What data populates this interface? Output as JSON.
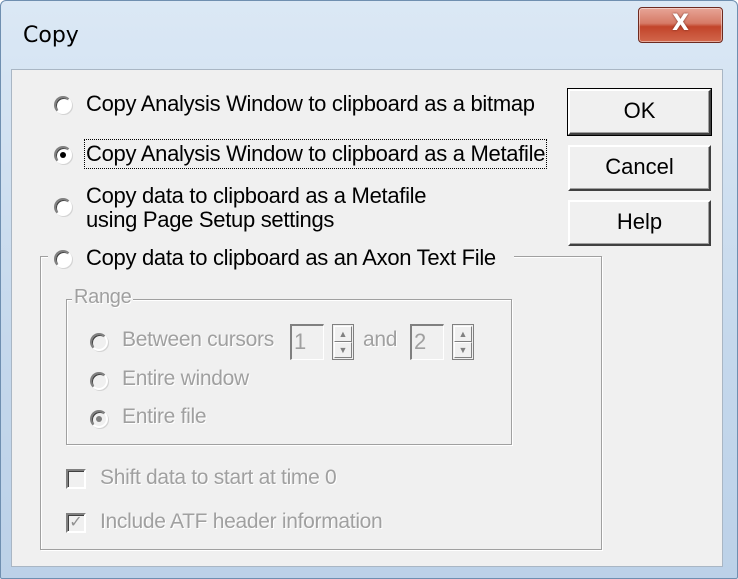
{
  "window": {
    "title": "Copy",
    "close_glyph": "X"
  },
  "options": {
    "bitmap": {
      "label": "Copy Analysis Window to clipboard as a bitmap",
      "selected": false
    },
    "metafile": {
      "label": "Copy Analysis Window to clipboard as a Metafile",
      "selected": true
    },
    "page_setup": {
      "label_line1": "Copy data to clipboard as a Metafile",
      "label_line2": "using Page Setup settings",
      "selected": false
    },
    "axon_text": {
      "label": "Copy data to clipboard as an Axon Text File",
      "selected": false
    }
  },
  "range": {
    "label": "Range",
    "between": {
      "label": "Between cursors",
      "from": "1",
      "and_label": "and",
      "to": "2",
      "selected": false
    },
    "entire_window": {
      "label": "Entire window",
      "selected": false
    },
    "entire_file": {
      "label": "Entire file",
      "selected": true
    }
  },
  "checkboxes": {
    "shift_time": {
      "label": "Shift data to start at time 0",
      "checked": false
    },
    "atf_header": {
      "label": "Include ATF header information",
      "checked": true
    }
  },
  "buttons": {
    "ok": "OK",
    "cancel": "Cancel",
    "help": "Help"
  },
  "icons": {
    "close": "close-icon",
    "check": "check-icon",
    "spin_up": "spin-up-icon",
    "spin_down": "spin-down-icon"
  }
}
